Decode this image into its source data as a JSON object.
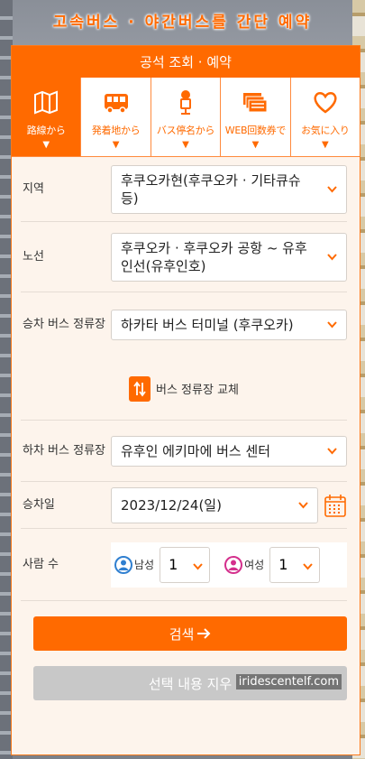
{
  "headline": "고속버스 · 야간버스를 간단 예약",
  "card_title": "공석 조회 · 예약",
  "tabs": [
    {
      "label": "路線から",
      "icon": "map-icon",
      "active": true
    },
    {
      "label": "発着地から",
      "icon": "bus-icon",
      "active": false
    },
    {
      "label": "バス停名から",
      "icon": "bus-stop-icon",
      "active": false
    },
    {
      "label": "WEB回数券で",
      "icon": "tickets-icon",
      "active": false
    },
    {
      "label": "お気に入り",
      "icon": "heart-icon",
      "active": false
    }
  ],
  "caret": "▼",
  "form": {
    "region": {
      "label": "지역",
      "value": "후쿠오카현(후쿠오카 · 기타큐슈 등)"
    },
    "route": {
      "label": "노선",
      "value": "후쿠오카 · 후쿠오카 공항 ~ 유후인선(유후인호)"
    },
    "boarding": {
      "label": "승차 버스 정류장",
      "value": "하카타 버스 터미널 (후쿠오카)"
    },
    "swap_label": "버스 정류장 교체",
    "alighting": {
      "label": "하차 버스 정류장",
      "value": "유후인 에키마에 버스 센터"
    },
    "date": {
      "label": "승차일",
      "value": "2023/12/24(일)"
    },
    "people": {
      "label": "사람 수",
      "male_label": "남성",
      "male_value": "1",
      "female_label": "여성",
      "female_value": "1"
    }
  },
  "search_label": "검색",
  "clear_label": "선택 내용 지우",
  "watermark": "iridescentelf.com",
  "colors": {
    "accent": "#ff6a00",
    "male": "#2f7fd0",
    "female": "#d42f8c"
  }
}
